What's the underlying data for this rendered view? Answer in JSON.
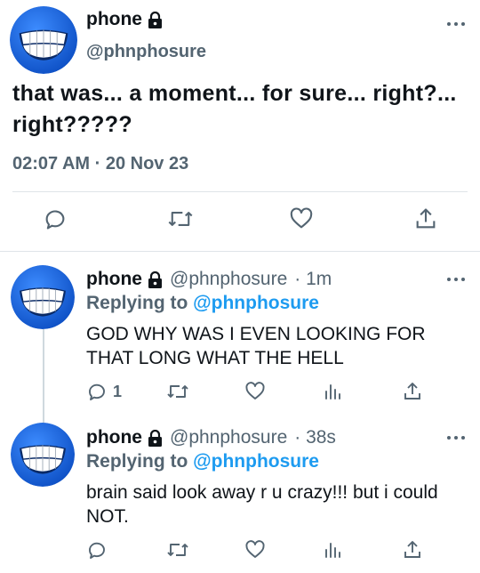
{
  "main_tweet": {
    "display_name": "phone",
    "handle": "@phnphosure",
    "text": "that was... a moment... for sure... right?... right?????",
    "timestamp": "02:07 AM · 20 Nov 23",
    "icons": [
      "lock-icon",
      "more-icon",
      "reply-icon",
      "retweet-icon",
      "like-icon",
      "share-icon"
    ]
  },
  "replies": [
    {
      "display_name": "phone",
      "handle": "@phnphosure",
      "time_ago": "· 1m",
      "replying_prefix": "Replying to ",
      "replying_to": "@phnphosure",
      "text": "GOD WHY WAS I EVEN LOOKING FOR THAT LONG WHAT THE HELL",
      "reply_count": "1"
    },
    {
      "display_name": "phone",
      "handle": "@phnphosure",
      "time_ago": "· 38s",
      "replying_prefix": "Replying to ",
      "replying_to": "@phnphosure",
      "text": "brain said look away r u crazy!!! but i could NOT.",
      "reply_count": ""
    }
  ],
  "colors": {
    "accent": "#1d9bf0",
    "secondary_text": "#536471",
    "primary_text": "#0f1419",
    "avatar_blue": "#1f6fe0"
  }
}
